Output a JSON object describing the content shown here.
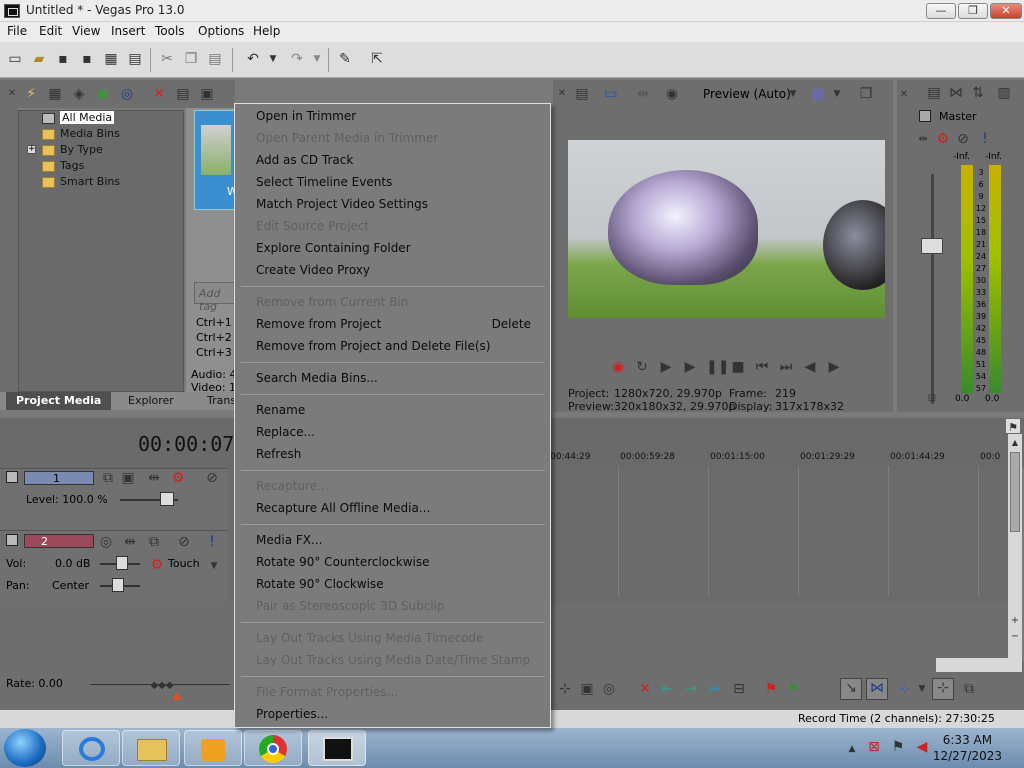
{
  "window": {
    "title": "Untitled * - Vegas Pro 13.0",
    "controls": [
      "—",
      "❐",
      "✕"
    ]
  },
  "menubar": {
    "items": [
      "File",
      "Edit",
      "View",
      "Insert",
      "Tools",
      "Options",
      "Help"
    ]
  },
  "project_media": {
    "tree": [
      "All Media",
      "Media Bins",
      "By Type",
      "Tags",
      "Smart Bins"
    ],
    "tree_expand": "+",
    "tabs": [
      "Project Media",
      "Explorer",
      "Trans"
    ],
    "add_tag_placeholder": "Add tag",
    "shortcuts": [
      "Ctrl+1",
      "Ctrl+2",
      "Ctrl+3"
    ],
    "audio_label": "Audio: 4",
    "video_label": "Video: 12",
    "thumb_label": "W"
  },
  "preview": {
    "mode_label": "Preview (Auto)",
    "project_label": "Project:",
    "project_value": "1280x720, 29.970p",
    "preview_label": "Preview:",
    "preview_value": "320x180x32, 29.970p",
    "frame_label": "Frame:",
    "frame_value": "219",
    "display_label": "Display:",
    "display_value": "317x178x32"
  },
  "mixer": {
    "title": "Master",
    "left_top": "-Inf.",
    "right_top": "-Inf.",
    "scale": [
      "3",
      "6",
      "9",
      "12",
      "15",
      "18",
      "21",
      "24",
      "27",
      "30",
      "33",
      "36",
      "39",
      "42",
      "45",
      "48",
      "51",
      "54",
      "57"
    ],
    "left_bottom": "0.0",
    "right_bottom": "0.0"
  },
  "timeline": {
    "timecode": "00:00:07;0",
    "ruler": [
      "00:44:29",
      "00:00:59:28",
      "00:01:15:00",
      "00:01:29:29",
      "00:01:44:29",
      "00:0"
    ],
    "video_track": {
      "number": "1",
      "level_label": "Level: 100.0 %"
    },
    "audio_track": {
      "number": "2",
      "vol_label": "Vol:",
      "vol_value": "0.0 dB",
      "pan_label": "Pan:",
      "pan_value": "Center",
      "touch_label": "Touch"
    },
    "rate_label": "Rate: 0.00"
  },
  "status": {
    "record_time": "Record Time (2 channels): 27:30:25"
  },
  "taskbar": {
    "time": "6:33 AM",
    "date": "12/27/2023"
  },
  "context_menu": {
    "items": [
      {
        "label": "Open in Trimmer",
        "enabled": true
      },
      {
        "label": "Open Parent Media in Trimmer",
        "enabled": false
      },
      {
        "label": "Add as CD Track",
        "enabled": true
      },
      {
        "label": "Select Timeline Events",
        "enabled": true
      },
      {
        "label": "Match Project Video Settings",
        "enabled": true
      },
      {
        "label": "Edit Source Project",
        "enabled": false
      },
      {
        "label": "Explore Containing Folder",
        "enabled": true
      },
      {
        "label": "Create Video Proxy",
        "enabled": true
      },
      {
        "label": "Remove from Current Bin",
        "enabled": false
      },
      {
        "label": "Remove from Project",
        "enabled": true,
        "shortcut": "Delete"
      },
      {
        "label": "Remove from Project and Delete File(s)",
        "enabled": true
      },
      {
        "label": "Search Media Bins...",
        "enabled": true
      },
      {
        "label": "Rename",
        "enabled": true
      },
      {
        "label": "Replace...",
        "enabled": true
      },
      {
        "label": "Refresh",
        "enabled": true
      },
      {
        "label": "Recapture...",
        "enabled": false
      },
      {
        "label": "Recapture All Offline Media...",
        "enabled": true
      },
      {
        "label": "Media FX...",
        "enabled": true
      },
      {
        "label": "Rotate 90° Counterclockwise",
        "enabled": true
      },
      {
        "label": "Rotate 90° Clockwise",
        "enabled": true
      },
      {
        "label": "Pair as Stereoscopic 3D Subclip",
        "enabled": false
      },
      {
        "label": "Lay Out Tracks Using Media Timecode",
        "enabled": false
      },
      {
        "label": "Lay Out Tracks Using Media Date/Time Stamp",
        "enabled": false
      },
      {
        "label": "File Format Properties...",
        "enabled": false
      },
      {
        "label": "Properties...",
        "enabled": true
      }
    ]
  }
}
